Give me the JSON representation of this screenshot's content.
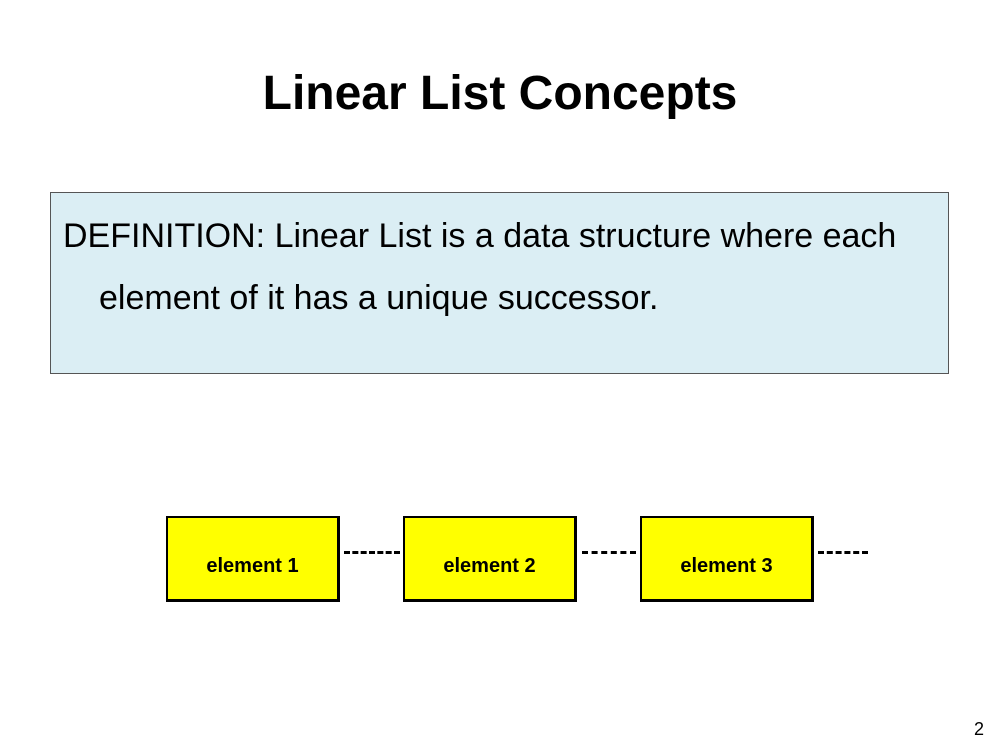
{
  "slide": {
    "title": "Linear List Concepts",
    "definition_term": "DEFINITION",
    "definition_text": ": Linear List is a data structure where each element of it has a unique successor.",
    "elements": [
      "element 1",
      "element 2",
      "element 3"
    ],
    "page_number": "2"
  },
  "colors": {
    "definition_box_fill": "#dbeef4",
    "element_fill": "#ffff00",
    "element_border": "#000000"
  }
}
